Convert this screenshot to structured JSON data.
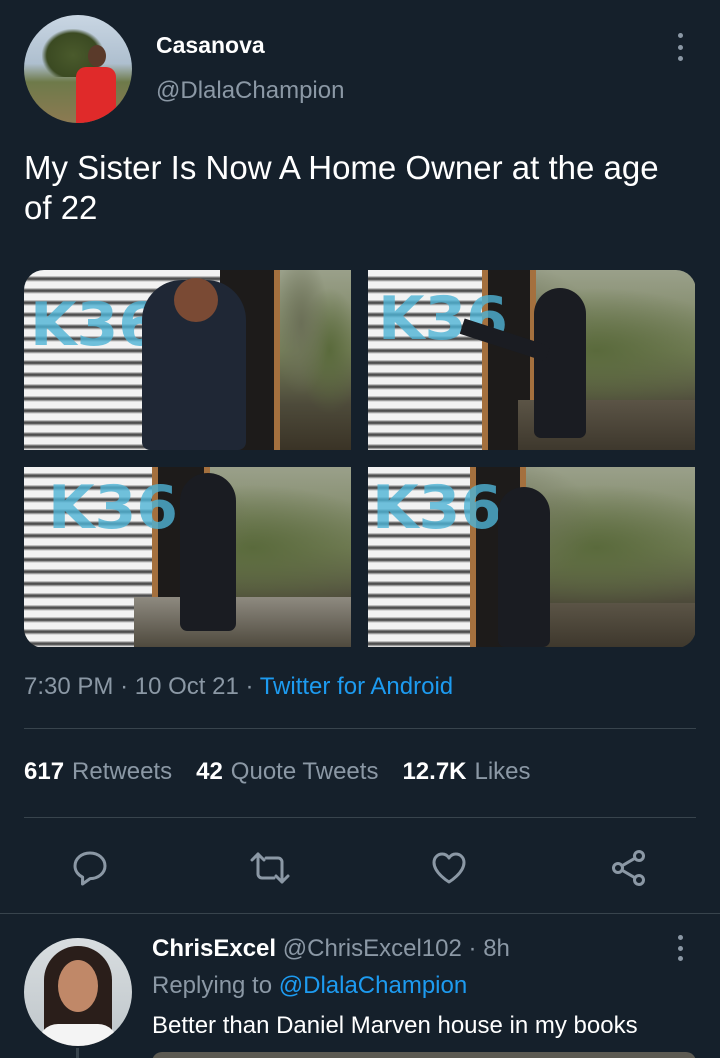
{
  "author": {
    "display_name": "Casanova",
    "handle": "@DlalaChampion"
  },
  "tweet": {
    "text": "My Sister Is Now A Home Owner at the age of 22",
    "time": "7:30 PM",
    "date": "10 Oct 21",
    "separator": "·",
    "source": "Twitter for Android",
    "photos": [
      {
        "graffiti": "K36"
      },
      {
        "graffiti": "K36"
      },
      {
        "graffiti": "K36"
      },
      {
        "graffiti": "K36"
      }
    ]
  },
  "stats": {
    "retweets_count": "617",
    "retweets_label": "Retweets",
    "quotes_count": "42",
    "quotes_label": "Quote Tweets",
    "likes_count": "12.7K",
    "likes_label": "Likes"
  },
  "actions": {
    "icons": [
      "reply-icon",
      "retweet-icon",
      "like-icon",
      "share-icon"
    ]
  },
  "reply": {
    "display_name": "ChrisExcel",
    "handle": "@ChrisExcel102",
    "separator": "·",
    "age": "8h",
    "replying_prefix": "Replying to",
    "replying_to": "@DlalaChampion",
    "text": "Better than Daniel Marven house in my books"
  },
  "colors": {
    "background": "#15202b",
    "secondary_text": "#8b98a5",
    "accent": "#1d9bf0",
    "divider": "#38444d"
  }
}
